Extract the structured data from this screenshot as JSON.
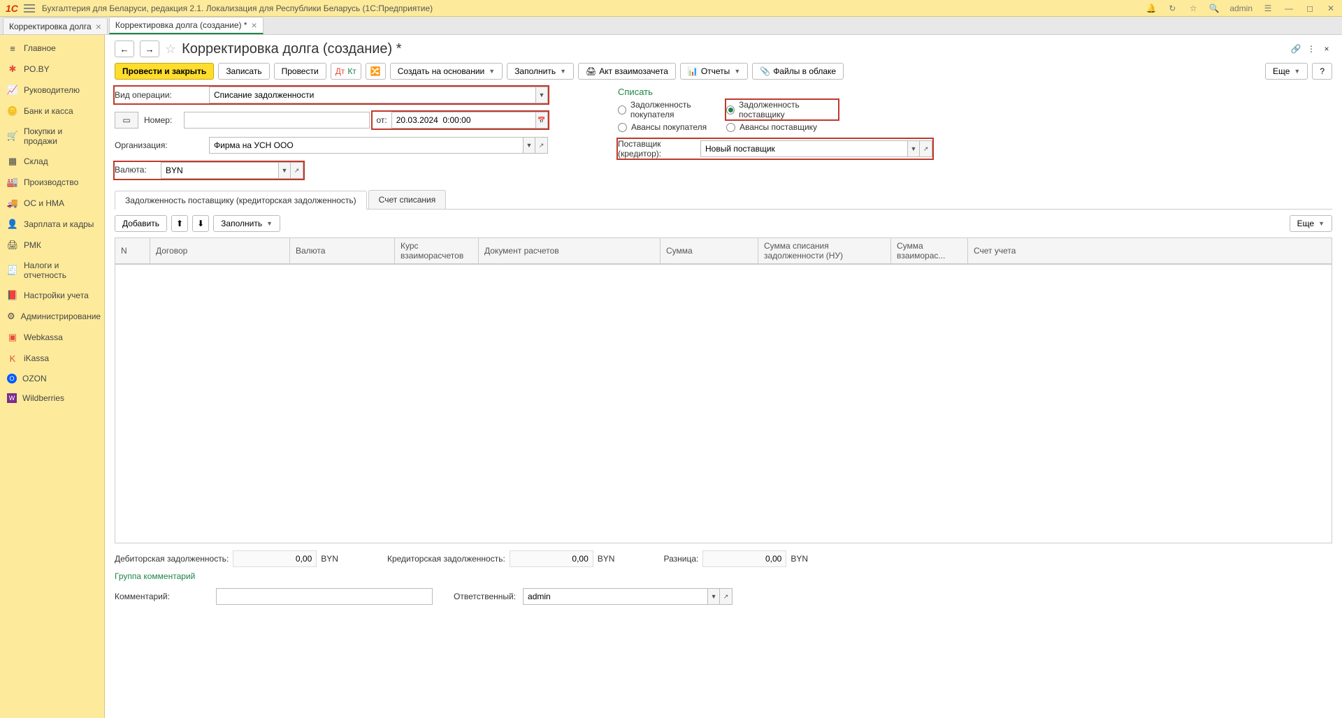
{
  "app": {
    "title": "Бухгалтерия для Беларуси, редакция 2.1. Локализация для Республики Беларусь   (1С:Предприятие)",
    "user": "admin"
  },
  "tabs": [
    {
      "label": "Корректировка долга"
    },
    {
      "label": "Корректировка долга (создание) *"
    }
  ],
  "sidebar": [
    {
      "label": "Главное"
    },
    {
      "label": "PO.BY"
    },
    {
      "label": "Руководителю"
    },
    {
      "label": "Банк и касса"
    },
    {
      "label": "Покупки и продажи"
    },
    {
      "label": "Склад"
    },
    {
      "label": "Производство"
    },
    {
      "label": "ОС и НМА"
    },
    {
      "label": "Зарплата и кадры"
    },
    {
      "label": "РМК"
    },
    {
      "label": "Налоги и отчетность"
    },
    {
      "label": "Настройки учета"
    },
    {
      "label": "Администрирование"
    },
    {
      "label": "Webkassa"
    },
    {
      "label": "iKassa"
    },
    {
      "label": "OZON"
    },
    {
      "label": "Wildberries"
    }
  ],
  "page": {
    "title": "Корректировка долга (создание) *"
  },
  "toolbar": {
    "post_close": "Провести и закрыть",
    "record": "Записать",
    "post": "Провести",
    "create_based": "Создать на основании",
    "fill": "Заполнить",
    "act": "Акт взаимозачета",
    "reports": "Отчеты",
    "files": "Файлы в облаке",
    "more": "Еще",
    "help": "?"
  },
  "form": {
    "operation_label": "Вид операции:",
    "operation_value": "Списание задолженности",
    "number_label": "Номер:",
    "date_label": "от:",
    "date_value": "20.03.2024  0:00:00",
    "org_label": "Организация:",
    "org_value": "Фирма на УСН ООО",
    "currency_label": "Валюта:",
    "currency_value": "BYN"
  },
  "writeoff": {
    "title": "Списать",
    "buyer_debt": "Задолженность покупателя",
    "supplier_debt": "Задолженность поставщику",
    "buyer_advance": "Авансы покупателя",
    "supplier_advance": "Авансы поставщику",
    "supplier_label": "Поставщик (кредитор):",
    "supplier_value": "Новый поставщик"
  },
  "subtabs": {
    "tab1": "Задолженность поставщику (кредиторская задолженность)",
    "tab2": "Счет списания"
  },
  "tabletoolbar": {
    "add": "Добавить",
    "fill": "Заполнить",
    "more": "Еще"
  },
  "columns": {
    "n": "N",
    "contract": "Договор",
    "currency": "Валюта",
    "rate": "Курс взаиморасчетов",
    "doc": "Документ расчетов",
    "sum": "Сумма",
    "sum_nu": "Сумма списания задолженности (НУ)",
    "sum_mutual": "Сумма взаиморас...",
    "account": "Счет учета"
  },
  "footer": {
    "debit_label": "Дебиторская задолженность:",
    "debit_value": "0,00",
    "debit_curr": "BYN",
    "credit_label": "Кредиторская задолженность:",
    "credit_value": "0,00",
    "credit_curr": "BYN",
    "diff_label": "Разница:",
    "diff_value": "0,00",
    "diff_curr": "BYN",
    "group_link": "Группа комментарий",
    "comment_label": "Комментарий:",
    "responsible_label": "Ответственный:",
    "responsible_value": "admin"
  }
}
